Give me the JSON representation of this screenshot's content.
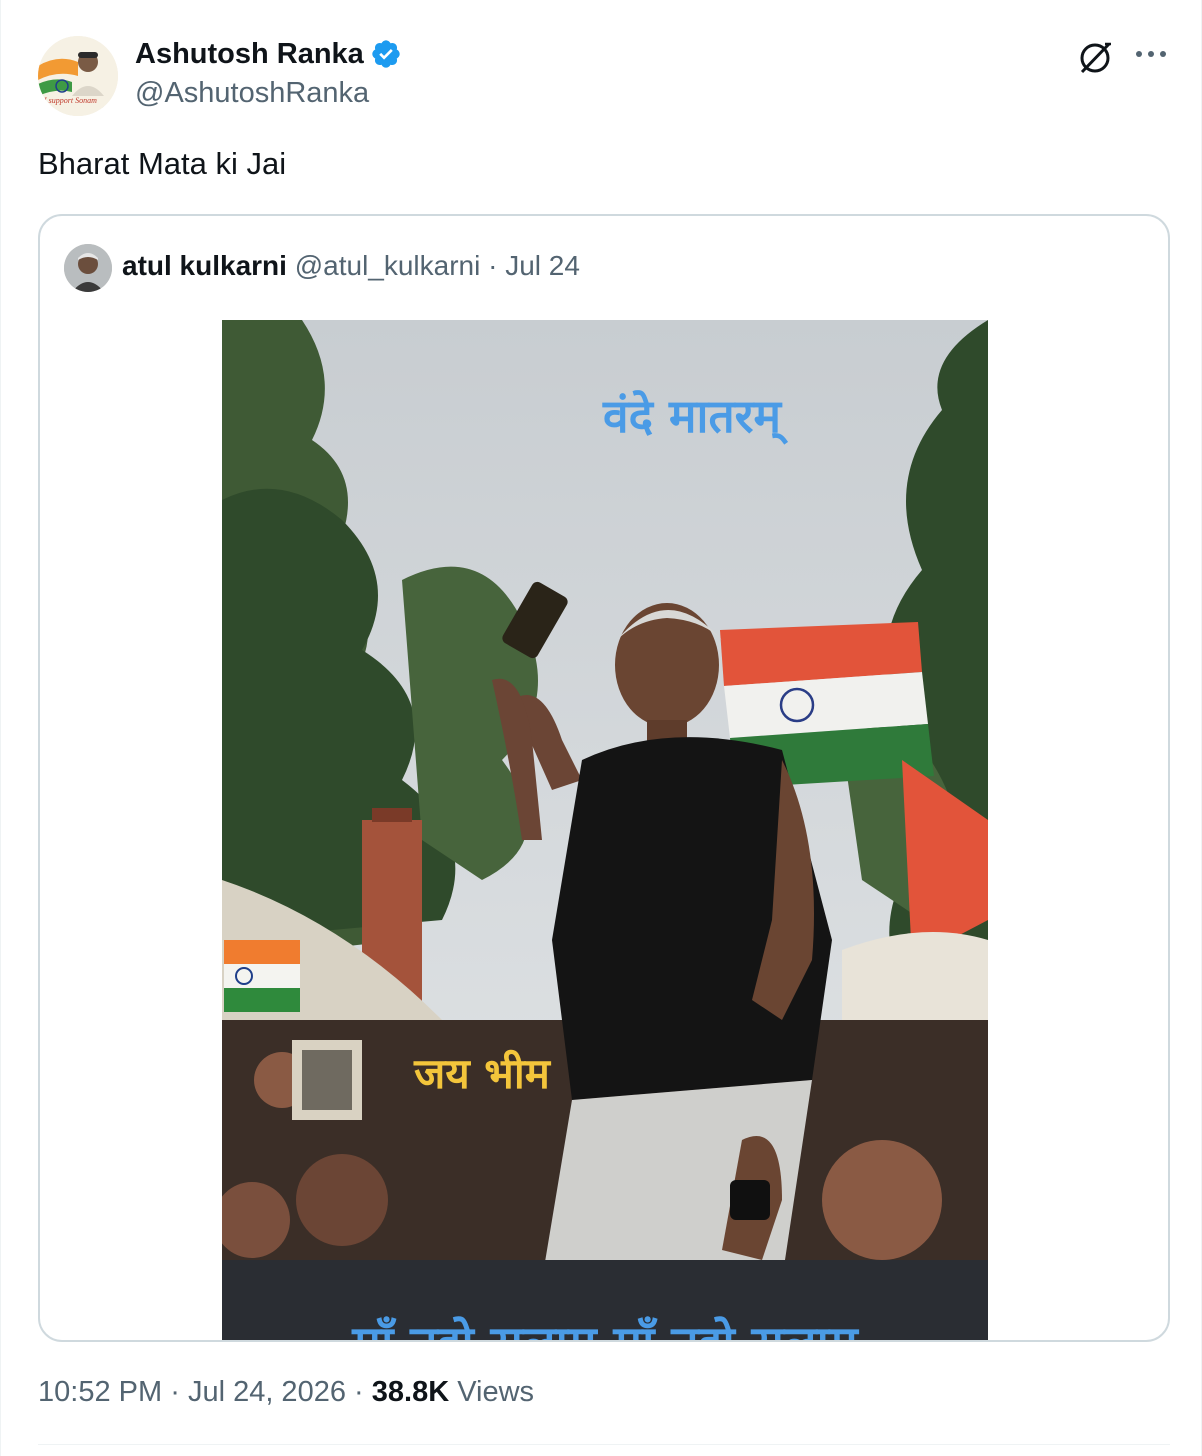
{
  "author": {
    "display_name": "Ashutosh Ranka",
    "handle": "@AshutoshRanka",
    "avatar_badge_text": "I support Sonam",
    "verified": true
  },
  "tweet": {
    "text": "Bharat Mata ki Jai"
  },
  "quoted_tweet": {
    "display_name": "atul kulkarni",
    "handle": "@atul_kulkarni",
    "separator": "·",
    "date": "Jul 24",
    "image_texts": {
      "top": "वंदे मातरम्",
      "middle": "जय भीम",
      "bottom": "माँ तुझे सलाम   माँ तुझे सलाम"
    }
  },
  "meta": {
    "time": "10:52 PM",
    "separator": "·",
    "date": "Jul 24, 2026",
    "views_count": "38.8K",
    "views_label": "Views"
  },
  "colors": {
    "text_primary": "#0f1419",
    "text_secondary": "#536471",
    "border": "#cfd9de",
    "verified_blue": "#1d9bf0",
    "overlay_blue": "#4a9be6",
    "overlay_yellow": "#f3c53b"
  },
  "icons": {
    "grok": "grok-icon",
    "more": "more-dots-icon",
    "verified": "verified-badge-icon"
  }
}
